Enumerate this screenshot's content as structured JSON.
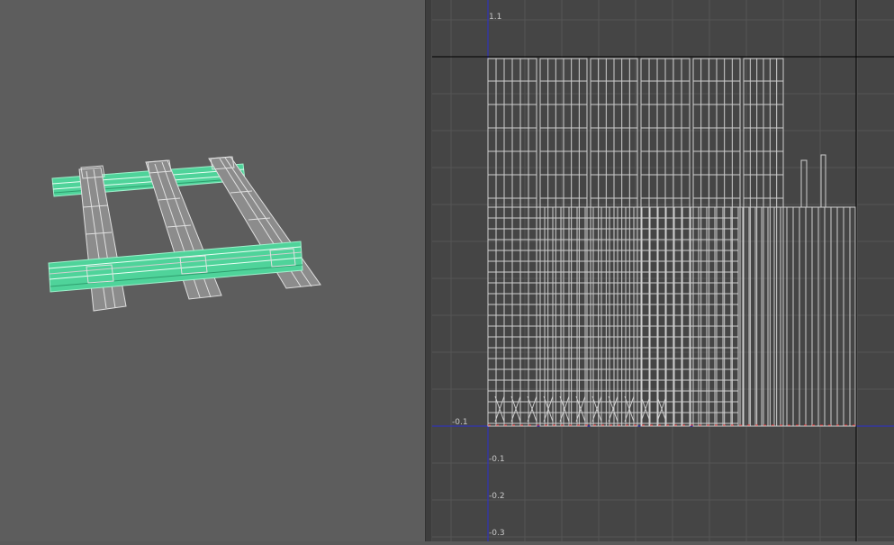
{
  "viewport_3d": {
    "object_icon": "rail-track-wireframe",
    "selection_color": "#5de0a8",
    "wire_color": "#d8d8d8"
  },
  "uv_editor": {
    "u_axis_labels": [
      "-0.1"
    ],
    "v_axis_labels": [
      "1.1",
      "-0.1",
      "-0.2",
      "-0.3"
    ],
    "axis_color": "#2a2fd0",
    "border_color": "#000000",
    "grid_color": "#555555",
    "uv_wire_color": "#cfcfcf",
    "seam_color": "#e03030"
  }
}
